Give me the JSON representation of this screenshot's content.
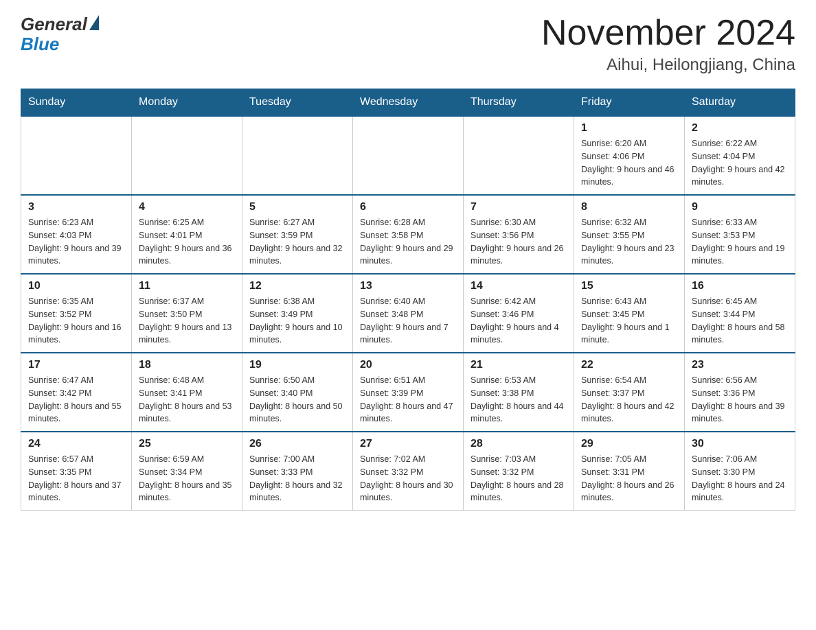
{
  "header": {
    "logo": {
      "general": "General",
      "blue": "Blue"
    },
    "title": "November 2024",
    "subtitle": "Aihui, Heilongjiang, China"
  },
  "days_of_week": [
    "Sunday",
    "Monday",
    "Tuesday",
    "Wednesday",
    "Thursday",
    "Friday",
    "Saturday"
  ],
  "weeks": [
    [
      {
        "day": "",
        "info": ""
      },
      {
        "day": "",
        "info": ""
      },
      {
        "day": "",
        "info": ""
      },
      {
        "day": "",
        "info": ""
      },
      {
        "day": "",
        "info": ""
      },
      {
        "day": "1",
        "info": "Sunrise: 6:20 AM\nSunset: 4:06 PM\nDaylight: 9 hours and 46 minutes."
      },
      {
        "day": "2",
        "info": "Sunrise: 6:22 AM\nSunset: 4:04 PM\nDaylight: 9 hours and 42 minutes."
      }
    ],
    [
      {
        "day": "3",
        "info": "Sunrise: 6:23 AM\nSunset: 4:03 PM\nDaylight: 9 hours and 39 minutes."
      },
      {
        "day": "4",
        "info": "Sunrise: 6:25 AM\nSunset: 4:01 PM\nDaylight: 9 hours and 36 minutes."
      },
      {
        "day": "5",
        "info": "Sunrise: 6:27 AM\nSunset: 3:59 PM\nDaylight: 9 hours and 32 minutes."
      },
      {
        "day": "6",
        "info": "Sunrise: 6:28 AM\nSunset: 3:58 PM\nDaylight: 9 hours and 29 minutes."
      },
      {
        "day": "7",
        "info": "Sunrise: 6:30 AM\nSunset: 3:56 PM\nDaylight: 9 hours and 26 minutes."
      },
      {
        "day": "8",
        "info": "Sunrise: 6:32 AM\nSunset: 3:55 PM\nDaylight: 9 hours and 23 minutes."
      },
      {
        "day": "9",
        "info": "Sunrise: 6:33 AM\nSunset: 3:53 PM\nDaylight: 9 hours and 19 minutes."
      }
    ],
    [
      {
        "day": "10",
        "info": "Sunrise: 6:35 AM\nSunset: 3:52 PM\nDaylight: 9 hours and 16 minutes."
      },
      {
        "day": "11",
        "info": "Sunrise: 6:37 AM\nSunset: 3:50 PM\nDaylight: 9 hours and 13 minutes."
      },
      {
        "day": "12",
        "info": "Sunrise: 6:38 AM\nSunset: 3:49 PM\nDaylight: 9 hours and 10 minutes."
      },
      {
        "day": "13",
        "info": "Sunrise: 6:40 AM\nSunset: 3:48 PM\nDaylight: 9 hours and 7 minutes."
      },
      {
        "day": "14",
        "info": "Sunrise: 6:42 AM\nSunset: 3:46 PM\nDaylight: 9 hours and 4 minutes."
      },
      {
        "day": "15",
        "info": "Sunrise: 6:43 AM\nSunset: 3:45 PM\nDaylight: 9 hours and 1 minute."
      },
      {
        "day": "16",
        "info": "Sunrise: 6:45 AM\nSunset: 3:44 PM\nDaylight: 8 hours and 58 minutes."
      }
    ],
    [
      {
        "day": "17",
        "info": "Sunrise: 6:47 AM\nSunset: 3:42 PM\nDaylight: 8 hours and 55 minutes."
      },
      {
        "day": "18",
        "info": "Sunrise: 6:48 AM\nSunset: 3:41 PM\nDaylight: 8 hours and 53 minutes."
      },
      {
        "day": "19",
        "info": "Sunrise: 6:50 AM\nSunset: 3:40 PM\nDaylight: 8 hours and 50 minutes."
      },
      {
        "day": "20",
        "info": "Sunrise: 6:51 AM\nSunset: 3:39 PM\nDaylight: 8 hours and 47 minutes."
      },
      {
        "day": "21",
        "info": "Sunrise: 6:53 AM\nSunset: 3:38 PM\nDaylight: 8 hours and 44 minutes."
      },
      {
        "day": "22",
        "info": "Sunrise: 6:54 AM\nSunset: 3:37 PM\nDaylight: 8 hours and 42 minutes."
      },
      {
        "day": "23",
        "info": "Sunrise: 6:56 AM\nSunset: 3:36 PM\nDaylight: 8 hours and 39 minutes."
      }
    ],
    [
      {
        "day": "24",
        "info": "Sunrise: 6:57 AM\nSunset: 3:35 PM\nDaylight: 8 hours and 37 minutes."
      },
      {
        "day": "25",
        "info": "Sunrise: 6:59 AM\nSunset: 3:34 PM\nDaylight: 8 hours and 35 minutes."
      },
      {
        "day": "26",
        "info": "Sunrise: 7:00 AM\nSunset: 3:33 PM\nDaylight: 8 hours and 32 minutes."
      },
      {
        "day": "27",
        "info": "Sunrise: 7:02 AM\nSunset: 3:32 PM\nDaylight: 8 hours and 30 minutes."
      },
      {
        "day": "28",
        "info": "Sunrise: 7:03 AM\nSunset: 3:32 PM\nDaylight: 8 hours and 28 minutes."
      },
      {
        "day": "29",
        "info": "Sunrise: 7:05 AM\nSunset: 3:31 PM\nDaylight: 8 hours and 26 minutes."
      },
      {
        "day": "30",
        "info": "Sunrise: 7:06 AM\nSunset: 3:30 PM\nDaylight: 8 hours and 24 minutes."
      }
    ]
  ]
}
